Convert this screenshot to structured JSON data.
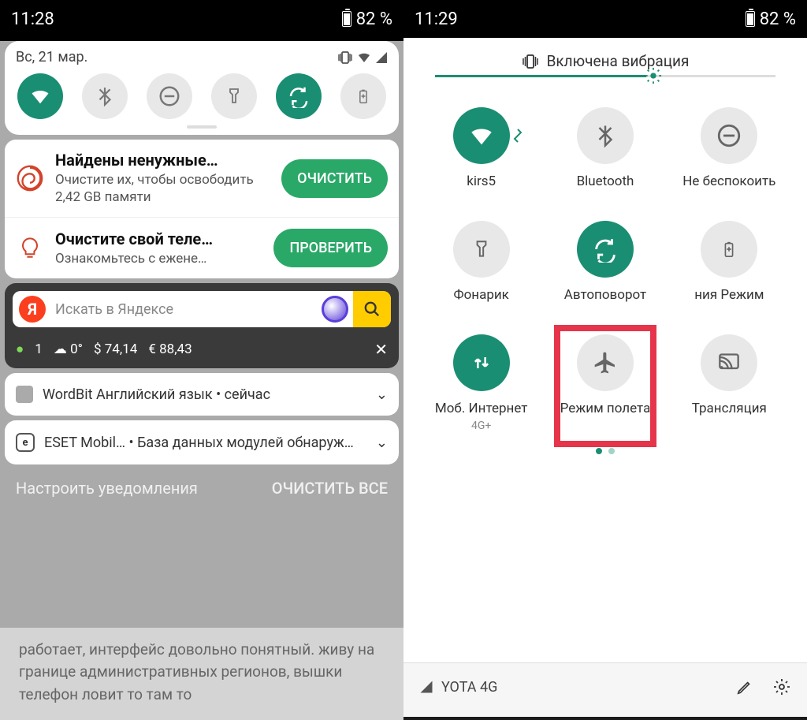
{
  "left": {
    "time": "11:28",
    "battery": "82 %",
    "date": "Вс, 21 мар.",
    "tiles": [
      "wifi",
      "bluetooth",
      "dnd",
      "flashlight",
      "rotate",
      "battery-saver"
    ],
    "notifications": [
      {
        "title": "Найдены ненужные…",
        "body": "Очистите их, чтобы освободить 2,42 GB памяти",
        "action": "ОЧИСТИТЬ"
      },
      {
        "title": "Очистите свой теле…",
        "body": "Ознакомьтесь с ежене…",
        "action": "ПРОВЕРИТЬ"
      }
    ],
    "search_placeholder": "Искать в Яндексе",
    "weather": {
      "green": "1",
      "temp": "0°",
      "usd": "74,14",
      "eur": "88,43"
    },
    "wordbit": "WordBit Английский язык • сейчас",
    "eset_app": "ESET Mobil…",
    "eset_text": " • База данных модулей обнаруж…",
    "configure": "Настроить уведомления",
    "clear_all": "ОЧИСТИТЬ ВСЕ",
    "review": "работает, интерфейс довольно понятный. живу на границе административных регионов, вышки телефон ловит то там то"
  },
  "right": {
    "time": "11:29",
    "battery": "82 %",
    "vibration": "Включена вибрация",
    "tiles": [
      {
        "label": "kirs5",
        "on": true,
        "icon": "wifi",
        "expand": true
      },
      {
        "label": "Bluetooth",
        "on": false,
        "icon": "bluetooth"
      },
      {
        "label": "Не беспокоить",
        "on": false,
        "icon": "dnd"
      },
      {
        "label": "Фонарик",
        "on": false,
        "icon": "flashlight"
      },
      {
        "label": "Автоповорот",
        "on": true,
        "icon": "rotate"
      },
      {
        "label": "ния     Режим",
        "on": false,
        "icon": "battery-saver",
        "partial": true
      },
      {
        "label": "Моб. Интернет",
        "sub": "4G+",
        "on": true,
        "icon": "data"
      },
      {
        "label": "Режим полета",
        "on": false,
        "icon": "airplane",
        "highlight": true
      },
      {
        "label": "Трансляция",
        "on": false,
        "icon": "cast"
      }
    ],
    "carrier": "YOTA 4G"
  }
}
